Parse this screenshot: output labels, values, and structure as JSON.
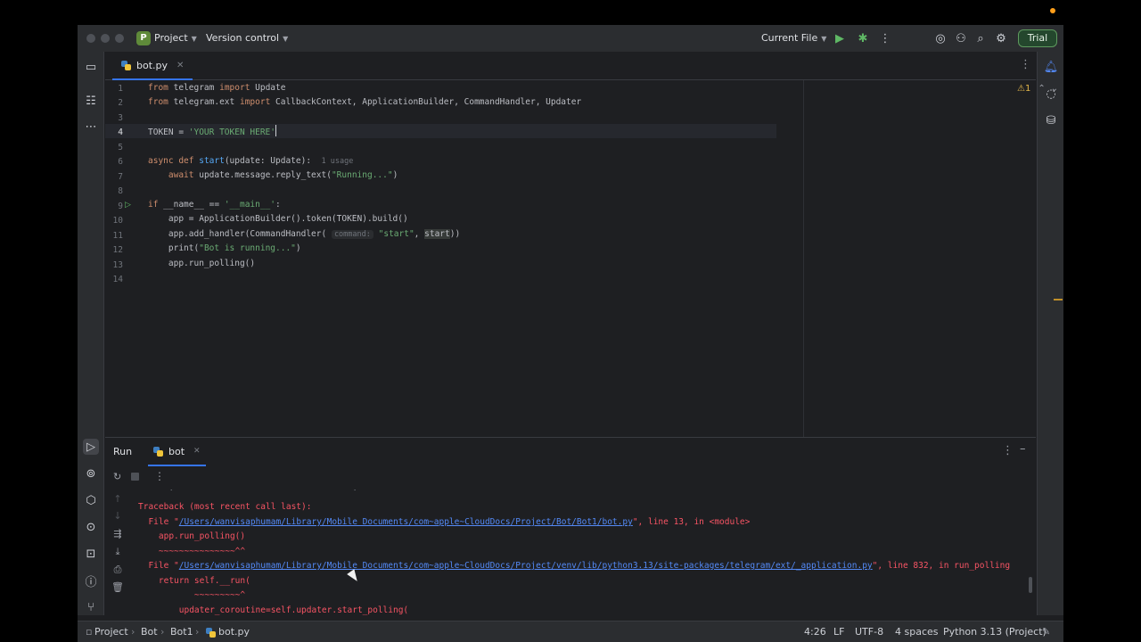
{
  "titlebar": {
    "project_letter": "P",
    "project_label": "Project",
    "vcs_label": "Version control",
    "run_config": "Current File",
    "trial_label": "Trial"
  },
  "tabs": [
    {
      "label": "bot.py"
    }
  ],
  "editor": {
    "warning_count": "1",
    "lines": [
      {
        "num": "1"
      },
      {
        "num": "2"
      },
      {
        "num": "3"
      },
      {
        "num": "4"
      },
      {
        "num": "5"
      },
      {
        "num": "6"
      },
      {
        "num": "7"
      },
      {
        "num": "8"
      },
      {
        "num": "9"
      },
      {
        "num": "10"
      },
      {
        "num": "11"
      },
      {
        "num": "12"
      },
      {
        "num": "13"
      },
      {
        "num": "14"
      }
    ],
    "code": {
      "l1": {
        "kw1": "from",
        "mod": " telegram ",
        "kw2": "import",
        "name": " Update"
      },
      "l2": {
        "kw1": "from",
        "mod": " telegram.ext ",
        "kw2": "import",
        "name": " CallbackContext, ApplicationBuilder, CommandHandler, Updater"
      },
      "l4": {
        "lhs": "TOKEN = ",
        "str": "'YOUR TOKEN HERE'"
      },
      "l6": {
        "kw1": "async",
        "kw2": " def",
        "fn": " start",
        "args": "(update: Update):",
        "usage": "1 usage"
      },
      "l7": {
        "kw": "await",
        "call": " update.message.reply_text(",
        "str": "\"Running...\"",
        "end": ")"
      },
      "l9": {
        "kw": "if",
        "mid": " __name__ == ",
        "str": "'__main__'",
        "end": ":"
      },
      "l10": {
        "text": "app = ApplicationBuilder().token(TOKEN).build()"
      },
      "l11": {
        "pre": "app.add_handler(CommandHandler(",
        "hint": "command:",
        "str": "\"start\"",
        "sep": ", ",
        "hl": "start",
        "end": "))"
      },
      "l12": {
        "pre": "print(",
        "str": "\"Bot is running...\"",
        "end": ")"
      },
      "l13": {
        "text": "app.run_polling()"
      }
    }
  },
  "run_panel": {
    "title": "Run",
    "tab_label": "bot",
    "console": {
      "traceback": "Traceback (most recent call last):",
      "file1_pre": "File \"",
      "file1_link": "/Users/wanvisaphumam/Library/Mobile Documents/com~apple~CloudDocs/Project/Bot/Bot1/bot.py",
      "file1_post": "\", line 13, in <module>",
      "code1": "app.run_polling()",
      "caret1": "~~~~~~~~~~~~~~~^^",
      "file2_pre": "File \"",
      "file2_link": "/Users/wanvisaphumam/Library/Mobile Documents/com~apple~CloudDocs/Project/venv/lib/python3.13/site-packages/telegram/ext/_application.py",
      "file2_post": "\", line 832, in run_polling",
      "code2": "return self.__run(",
      "caret2": "~~~~~~~~~^",
      "code3": "updater_coroutine=self.updater.start_polling("
    }
  },
  "statusbar": {
    "breadcrumb": [
      "Project",
      "Bot",
      "Bot1",
      "bot.py"
    ],
    "position": "4:26",
    "line_sep": "LF",
    "encoding": "UTF-8",
    "indent": "4 spaces",
    "interpreter": "Python 3.13 (Project)"
  },
  "colors": {
    "accent": "#3574f0",
    "error": "#f75464",
    "link": "#548af7",
    "keyword": "#cf8e6d",
    "string": "#6aab73"
  }
}
